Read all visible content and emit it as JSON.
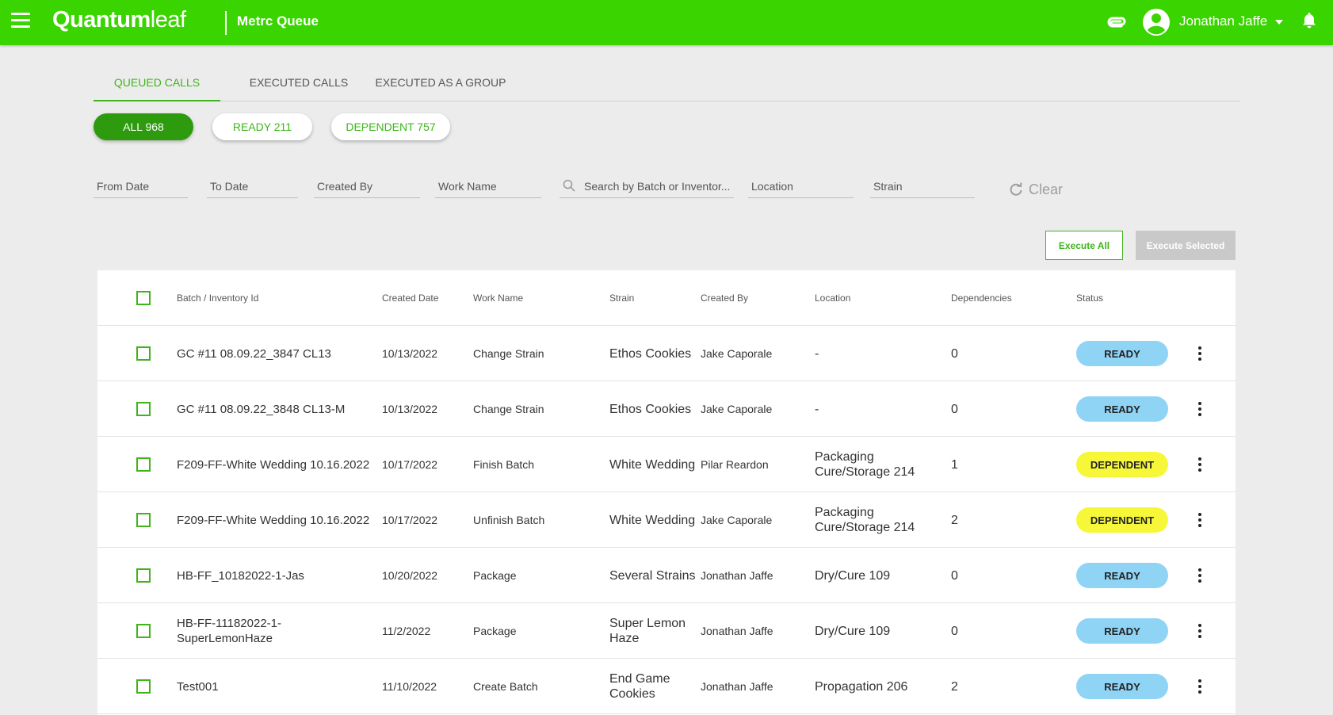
{
  "header": {
    "logo_bold": "Quantum",
    "logo_light": "leaf",
    "app_title": "Metrc Queue",
    "user_name": "Jonathan Jaffe",
    "icons": {
      "menu": "hamburger-menu-icon",
      "link": "paperclip-icon",
      "avatar": "account-circle-icon",
      "caret": "caret-down-icon",
      "notifications": "bell-icon"
    }
  },
  "tabs": [
    {
      "label": "QUEUED CALLS",
      "active": true
    },
    {
      "label": "EXECUTED CALLS",
      "active": false
    },
    {
      "label": "EXECUTED AS A GROUP",
      "active": false
    }
  ],
  "pills": [
    {
      "label": "ALL 968",
      "active": true
    },
    {
      "label": "READY 211",
      "active": false
    },
    {
      "label": "DEPENDENT 757",
      "active": false
    }
  ],
  "filters": {
    "from_date": "From Date",
    "to_date": "To Date",
    "created_by": "Created By",
    "work_name": "Work Name",
    "search": "Search by Batch or Inventor...",
    "location": "Location",
    "strain": "Strain",
    "clear": "Clear"
  },
  "actions": {
    "execute_all": "Execute All",
    "execute_selected": "Execute Selected"
  },
  "table": {
    "columns": {
      "batch": "Batch / Inventory Id",
      "created_date": "Created Date",
      "work_name": "Work Name",
      "strain": "Strain",
      "created_by": "Created By",
      "location": "Location",
      "dependencies": "Dependencies",
      "status": "Status"
    },
    "rows": [
      {
        "batch": "GC #11 08.09.22_3847 CL13",
        "created_date": "10/13/2022",
        "work_name": "Change Strain",
        "strain": "Ethos Cookies",
        "created_by": "Jake Caporale",
        "location": "-",
        "dependencies": "0",
        "status": "READY"
      },
      {
        "batch": "GC #11 08.09.22_3848 CL13-M",
        "created_date": "10/13/2022",
        "work_name": "Change Strain",
        "strain": "Ethos Cookies",
        "created_by": "Jake Caporale",
        "location": "-",
        "dependencies": "0",
        "status": "READY"
      },
      {
        "batch": "F209-FF-White Wedding 10.16.2022",
        "created_date": "10/17/2022",
        "work_name": "Finish Batch",
        "strain": "White Wedding",
        "created_by": "Pilar Reardon",
        "location": "Packaging Cure/Storage 214",
        "dependencies": "1",
        "status": "DEPENDENT"
      },
      {
        "batch": "F209-FF-White Wedding 10.16.2022",
        "created_date": "10/17/2022",
        "work_name": "Unfinish Batch",
        "strain": "White Wedding",
        "created_by": "Jake Caporale",
        "location": "Packaging Cure/Storage 214",
        "dependencies": "2",
        "status": "DEPENDENT"
      },
      {
        "batch": "HB-FF_10182022-1-Jas",
        "created_date": "10/20/2022",
        "work_name": "Package",
        "strain": "Several Strains",
        "created_by": "Jonathan Jaffe",
        "location": "Dry/Cure 109",
        "dependencies": "0",
        "status": "READY"
      },
      {
        "batch": "HB-FF-11182022-1-SuperLemonHaze",
        "created_date": "11/2/2022",
        "work_name": "Package",
        "strain": "Super Lemon Haze",
        "created_by": "Jonathan Jaffe",
        "location": "Dry/Cure 109",
        "dependencies": "0",
        "status": "READY"
      },
      {
        "batch": "Test001",
        "created_date": "11/10/2022",
        "work_name": "Create Batch",
        "strain": "End Game Cookies",
        "created_by": "Jonathan Jaffe",
        "location": "Propagation 206",
        "dependencies": "2",
        "status": "READY"
      }
    ]
  },
  "colors": {
    "brand_green": "#3ad400",
    "accent_green": "#3fb51b",
    "pill_active": "#2d9b0d",
    "status_ready": "#8fd3f5",
    "status_dependent": "#f7f73a"
  }
}
